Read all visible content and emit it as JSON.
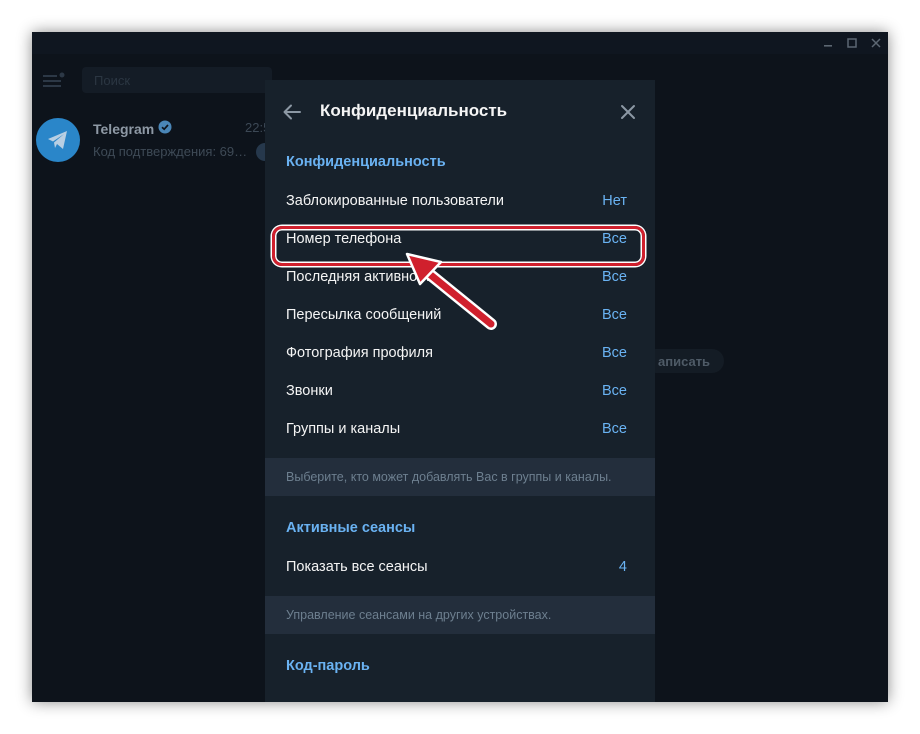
{
  "window": {
    "title_bar": {
      "buttons": [
        "minimize-icon",
        "maximize-icon",
        "close-icon"
      ]
    }
  },
  "sidebar": {
    "menu_icon": "hamburger-menu-icon",
    "search": {
      "placeholder": "Поиск"
    },
    "chats": [
      {
        "name": "Telegram",
        "verified_icon": "verified-badge-icon",
        "time": "22:5",
        "preview": "Код подтверждения: 69…",
        "avatar_icon": "telegram-logo-icon"
      }
    ]
  },
  "background": {
    "pill_label": "аписать"
  },
  "modal": {
    "title": "Конфиденциальность",
    "back_icon": "arrow-left-icon",
    "close_icon": "close-icon",
    "sections": [
      {
        "title": "Конфиденциальность",
        "rows": [
          {
            "label": "Заблокированные пользователи",
            "value": "Нет"
          },
          {
            "label": "Номер телефона",
            "value": "Все"
          },
          {
            "label": "Последняя активность",
            "value": "Все"
          },
          {
            "label": "Пересылка сообщений",
            "value": "Все"
          },
          {
            "label": "Фотография профиля",
            "value": "Все"
          },
          {
            "label": "Звонки",
            "value": "Все"
          },
          {
            "label": "Группы и каналы",
            "value": "Все"
          }
        ],
        "note": "Выберите, кто может добавлять Вас в группы и каналы."
      },
      {
        "title": "Активные сеансы",
        "rows": [
          {
            "label": "Показать все сеансы",
            "value": "4"
          }
        ],
        "note": "Управление сеансами на других устройствах."
      },
      {
        "title": "Код-пароль"
      }
    ]
  },
  "annotation": {
    "highlighted_row": "Номер телефона",
    "highlight_color": "#d0202d",
    "arrow_icon": "red-arrow-pointer"
  },
  "colors": {
    "app_background": "#0d131b",
    "panel_background": "#17212b",
    "accent": "#6ab2f2",
    "note_background": "#232e3c"
  }
}
